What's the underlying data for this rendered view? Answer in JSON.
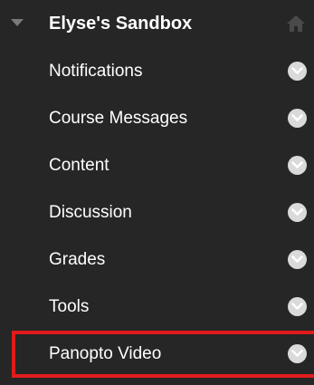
{
  "course": {
    "title": "Elyse's Sandbox",
    "collapse_icon": "triangle-down-icon",
    "home_icon": "home-icon"
  },
  "menu": {
    "items": [
      {
        "label": "Notifications",
        "icon": "chevron-down-circle-icon"
      },
      {
        "label": "Course Messages",
        "icon": "chevron-down-circle-icon"
      },
      {
        "label": "Content",
        "icon": "chevron-down-circle-icon"
      },
      {
        "label": "Discussion",
        "icon": "chevron-down-circle-icon"
      },
      {
        "label": "Grades",
        "icon": "chevron-down-circle-icon"
      },
      {
        "label": "Tools",
        "icon": "chevron-down-circle-icon"
      },
      {
        "label": "Panopto Video",
        "icon": "chevron-down-circle-icon",
        "highlighted": true
      }
    ]
  },
  "colors": {
    "background": "#262626",
    "text": "#ffffff",
    "action_circle": "#dadada",
    "highlight": "#e11b1b"
  }
}
